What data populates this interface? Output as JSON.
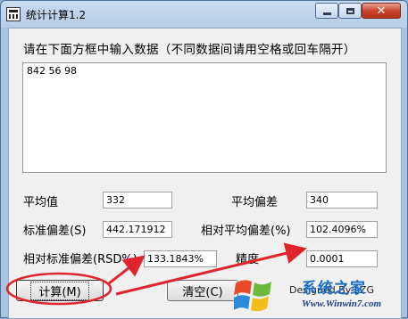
{
  "window": {
    "title": "统计计算1.2",
    "minimize_label": "minimize",
    "maximize_label": "maximize",
    "close_label": "✕"
  },
  "main": {
    "instruction": "请在下面方框中输入数据（不同数据间请用空格或回车隔开）",
    "input_data": "842 56 98"
  },
  "results": {
    "mean_label": "平均值",
    "mean_value": "332",
    "mean_dev_label": "平均偏差",
    "mean_dev_value": "340",
    "std_label": "标准偏差(S)",
    "std_value": "442.171912",
    "rel_mean_dev_label": "相对平均偏差(%)",
    "rel_mean_dev_value": "102.4096%",
    "rel_std_label": "相对标准偏差(RSD%)",
    "rel_std_value": "133.1843%",
    "precision_label": "精度",
    "precision_value": "0.0001"
  },
  "buttons": {
    "calculate": "计算(M)",
    "clear": "清空(C)"
  },
  "footer": {
    "designed_by": "Designed By LZG"
  },
  "watermark": {
    "site": "系统之家",
    "url": "Www.Winwin7.com"
  },
  "colors": {
    "annotation_red": "#e0242e",
    "titlebar_blue": "#b5cde6"
  }
}
